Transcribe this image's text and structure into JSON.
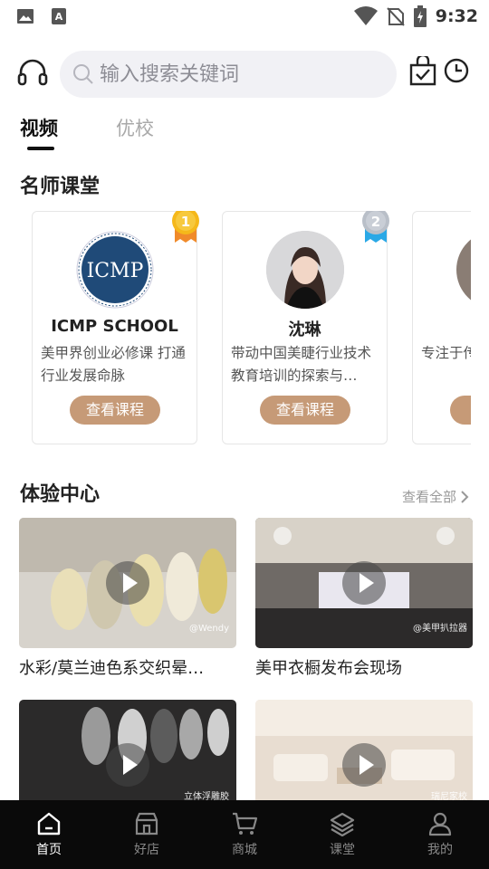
{
  "status_bar": {
    "time": "9:32"
  },
  "search": {
    "placeholder": "输入搜索关键词"
  },
  "tabs": [
    {
      "label": "视频",
      "active": true
    },
    {
      "label": "优校",
      "active": false
    }
  ],
  "teachers": {
    "title": "名师课堂",
    "cards": [
      {
        "name": "ICMP SCHOOL",
        "desc": "美甲界创业必修课 打通行业发展命脉",
        "button": "查看课程",
        "rank": "1",
        "logo_text": "ICMP"
      },
      {
        "name": "沈琳",
        "desc": "带动中国美睫行业技术教育培训的探索与…",
        "button": "查看课程",
        "rank": "2"
      },
      {
        "name": "",
        "desc": "专注于传的知识型",
        "button": "查",
        "rank": ""
      }
    ]
  },
  "experience": {
    "title": "体验中心",
    "more_label": "查看全部",
    "videos": [
      {
        "title": "水彩/莫兰迪色系交织晕…",
        "watermark": "@Wendy"
      },
      {
        "title": "美甲衣橱发布会现场",
        "watermark": "@美甲扒拉器"
      },
      {
        "title": "",
        "watermark": "立体浮雕胶"
      },
      {
        "title": "",
        "watermark": "瑞尼家校"
      }
    ]
  },
  "bottom_nav": [
    {
      "label": "首页",
      "icon": "home-icon",
      "active": true
    },
    {
      "label": "好店",
      "icon": "store-icon",
      "active": false
    },
    {
      "label": "商城",
      "icon": "cart-icon",
      "active": false
    },
    {
      "label": "课堂",
      "icon": "layers-icon",
      "active": false
    },
    {
      "label": "我的",
      "icon": "user-icon",
      "active": false
    }
  ],
  "colors": {
    "accent_button": "#c69a77",
    "nav_bg": "#0a0a0a",
    "search_bg": "#f1f1f5",
    "gold_medal": "#f5b81a",
    "silver_medal": "#b9bfc8"
  }
}
